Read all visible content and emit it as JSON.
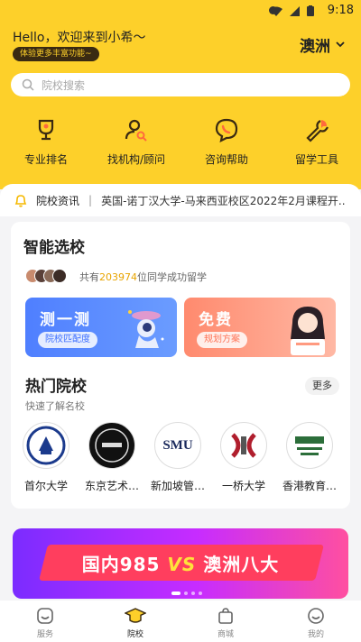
{
  "status": {
    "time": "9:18"
  },
  "header": {
    "greeting": "Hello，欢迎来到小希〜",
    "tag": "体验更多丰富功能~",
    "location": "澳洲",
    "search_placeholder": "院校搜索"
  },
  "nav": [
    {
      "label": "专业排名",
      "icon": "trophy-icon"
    },
    {
      "label": "找机构/顾问",
      "icon": "person-search-icon"
    },
    {
      "label": "咨询帮助",
      "icon": "phone-chat-icon"
    },
    {
      "label": "留学工具",
      "icon": "wrench-icon"
    }
  ],
  "notice": {
    "title": "院校资讯",
    "text": "英国-诺丁汉大学-马来西亚校区2022年2月课程开..."
  },
  "smart": {
    "title": "智能选校",
    "success_prefix": "共有",
    "success_count": "203974",
    "success_suffix": "位同学成功留学",
    "promo1_title": "测一测",
    "promo1_sub": "院校匹配度",
    "promo2_title": "免费",
    "promo2_sub": "规划方案"
  },
  "hot": {
    "title": "热门院校",
    "subtitle": "快速了解名校",
    "more": "更多",
    "schools": [
      {
        "name": "首尔大学",
        "logo": "seoul-university-logo-icon"
      },
      {
        "name": "东京艺术…",
        "logo": "tokyo-arts-logo-icon"
      },
      {
        "name": "新加坡管…",
        "logo": "smu-logo-icon",
        "logo_text": "SMU"
      },
      {
        "name": "一桥大学",
        "logo": "hitotsubashi-logo-icon"
      },
      {
        "name": "香港教育…",
        "logo": "hk-education-logo-icon"
      }
    ]
  },
  "banner": {
    "left": "国内985",
    "vs": "VS",
    "right": "澳洲八大"
  },
  "tabs": [
    {
      "label": "服务",
      "icon": "smile-icon",
      "active": false
    },
    {
      "label": "院校",
      "icon": "graduation-cap-icon",
      "active": true
    },
    {
      "label": "商城",
      "icon": "shopping-bag-icon",
      "active": false
    },
    {
      "label": "我的",
      "icon": "profile-icon",
      "active": false
    }
  ],
  "colors": {
    "brand_yellow": "#fdd02a",
    "accent_blue": "#4f7fff",
    "accent_coral": "#ff8a6e"
  }
}
